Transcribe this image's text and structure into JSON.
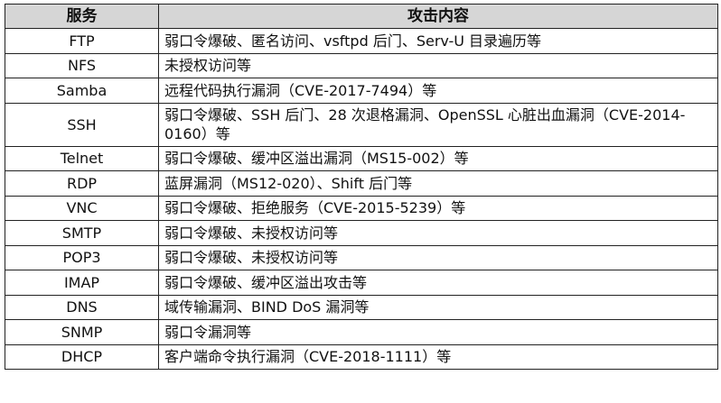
{
  "table": {
    "headers": [
      "服务",
      "攻击内容"
    ],
    "rows": [
      {
        "service": "FTP",
        "attack": "弱口令爆破、匿名访问、vsftpd 后门、Serv-U 目录遍历等"
      },
      {
        "service": "NFS",
        "attack": "未授权访问等"
      },
      {
        "service": "Samba",
        "attack": "远程代码执行漏洞（CVE-2017-7494）等"
      },
      {
        "service": "SSH",
        "attack": "弱口令爆破、SSH 后门、28 次退格漏洞、OpenSSL 心脏出血漏洞（CVE-2014-0160）等"
      },
      {
        "service": "Telnet",
        "attack": "弱口令爆破、缓冲区溢出漏洞（MS15-002）等"
      },
      {
        "service": "RDP",
        "attack": "蓝屏漏洞（MS12-020）、Shift 后门等"
      },
      {
        "service": "VNC",
        "attack": "弱口令爆破、拒绝服务（CVE-2015-5239）等"
      },
      {
        "service": "SMTP",
        "attack": "弱口令爆破、未授权访问等"
      },
      {
        "service": "POP3",
        "attack": "弱口令爆破、未授权访问等"
      },
      {
        "service": "IMAP",
        "attack": "弱口令爆破、缓冲区溢出攻击等"
      },
      {
        "service": "DNS",
        "attack": "域传输漏洞、BIND DoS 漏洞等"
      },
      {
        "service": "SNMP",
        "attack": "弱口令漏洞等"
      },
      {
        "service": "DHCP",
        "attack": "客户端命令执行漏洞（CVE-2018-1111）等"
      }
    ]
  }
}
